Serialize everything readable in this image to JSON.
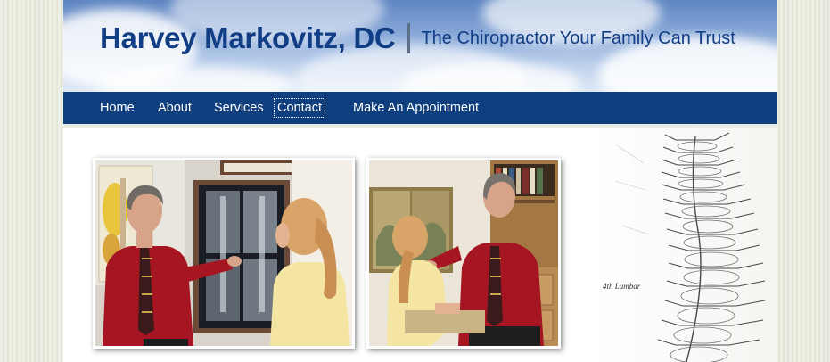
{
  "header": {
    "name": "Harvey Markovitz, DC",
    "tagline": "The Chiropractor Your Family Can Trust"
  },
  "nav": {
    "items": [
      {
        "label": "Home"
      },
      {
        "label": "About"
      },
      {
        "label": "Services"
      },
      {
        "label": "Contact",
        "active": true
      },
      {
        "label": "Make An Appointment"
      }
    ]
  },
  "photos": [
    {
      "subject": "chiropractor-showing-xray"
    },
    {
      "subject": "chiropractor-adjusting-patient"
    }
  ],
  "decor": {
    "spine_caption": "4th Lumbar"
  },
  "colors": {
    "brand_blue": "#0f3f7e",
    "title_blue": "#123e86",
    "shirt_red": "#a51622"
  }
}
